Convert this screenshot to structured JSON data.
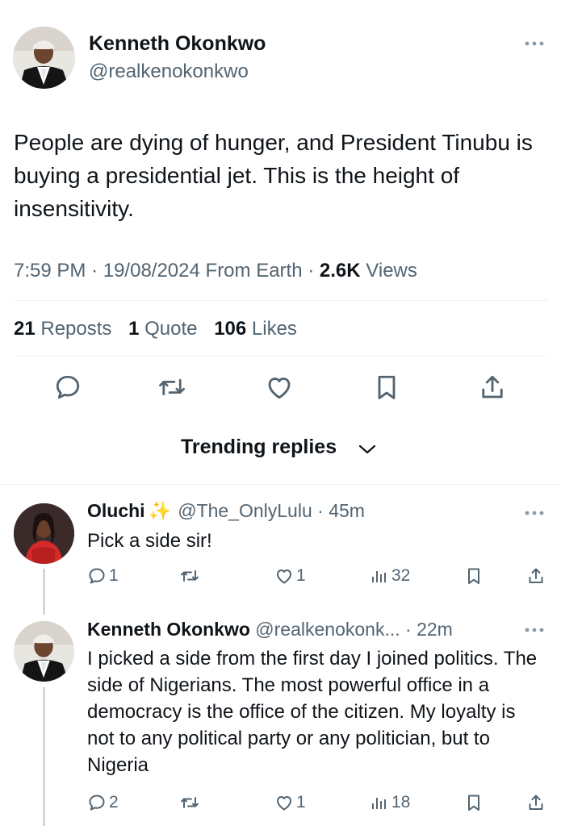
{
  "tweet": {
    "author_name": "Kenneth Okonkwo",
    "author_handle": "@realkenokonkwo",
    "text": "People are dying of hunger, and President Tinubu is buying a presidential jet. This is the height of insensitivity.",
    "time": "7:59 PM",
    "date": "19/08/2024",
    "source": "From Earth",
    "views_count": "2.6K",
    "views_label": "Views",
    "reposts_count": "21",
    "reposts_label": "Reposts",
    "quotes_count": "1",
    "quotes_label": "Quote",
    "likes_count": "106",
    "likes_label": "Likes"
  },
  "actions": {
    "reply_icon": "speech-bubble",
    "repost_icon": "repost-arrows",
    "like_icon": "heart",
    "bookmark_icon": "bookmark",
    "share_icon": "share-upload"
  },
  "replies_header": {
    "label": "Trending replies"
  },
  "replies": [
    {
      "name": "Oluchi",
      "emoji": "✨",
      "handle": "@The_OnlyLulu",
      "time": "45m",
      "text": "Pick a side sir!",
      "reply_count": "1",
      "repost_count": "",
      "like_count": "1",
      "view_count": "32"
    },
    {
      "name": "Kenneth Okonkwo",
      "emoji": "",
      "handle": "@realkenokonk...",
      "time": "22m",
      "text": "I picked a side from the first day I joined politics. The side of Nigerians. The most powerful office in a democracy is the office of the citizen. My loyalty is not to any political party or any politician, but to Nigeria",
      "reply_count": "2",
      "repost_count": "",
      "like_count": "1",
      "view_count": "18"
    }
  ],
  "colors": {
    "text": "#0f1419",
    "muted": "#536471",
    "divider": "#eff3f4",
    "thread_line": "#cfd9de",
    "sparkle": "#f7c948"
  }
}
